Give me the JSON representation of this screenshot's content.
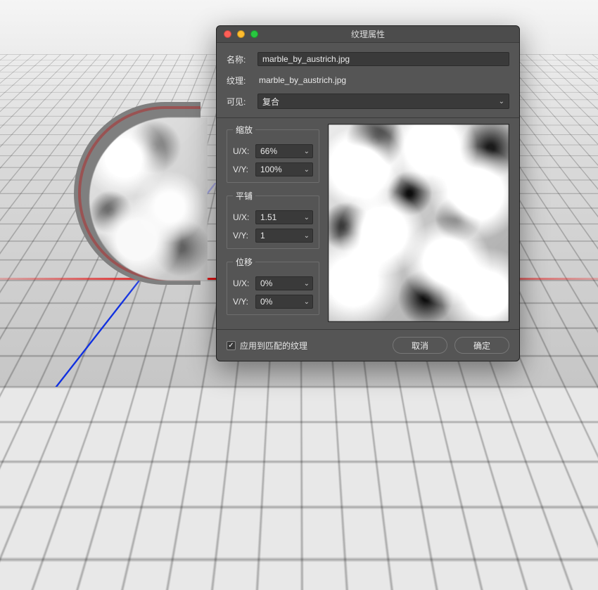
{
  "dialog": {
    "title": "纹理属性",
    "name_label": "名称:",
    "name_value": "marble_by_austrich.jpg",
    "texture_label": "纹理:",
    "texture_value": "marble_by_austrich.jpg",
    "visible_label": "可见:",
    "visible_value": "复合"
  },
  "scale": {
    "legend": "缩放",
    "ux_label": "U/X:",
    "ux_value": "66%",
    "vy_label": "V/Y:",
    "vy_value": "100%"
  },
  "tile": {
    "legend": "平铺",
    "ux_label": "U/X:",
    "ux_value": "1.51",
    "vy_label": "V/Y:",
    "vy_value": "1"
  },
  "offset": {
    "legend": "位移",
    "ux_label": "U/X:",
    "ux_value": "0%",
    "vy_label": "V/Y:",
    "vy_value": "0%"
  },
  "footer": {
    "apply_label": "应用到匹配的纹理",
    "apply_checked": true,
    "cancel": "取消",
    "ok": "确定"
  }
}
